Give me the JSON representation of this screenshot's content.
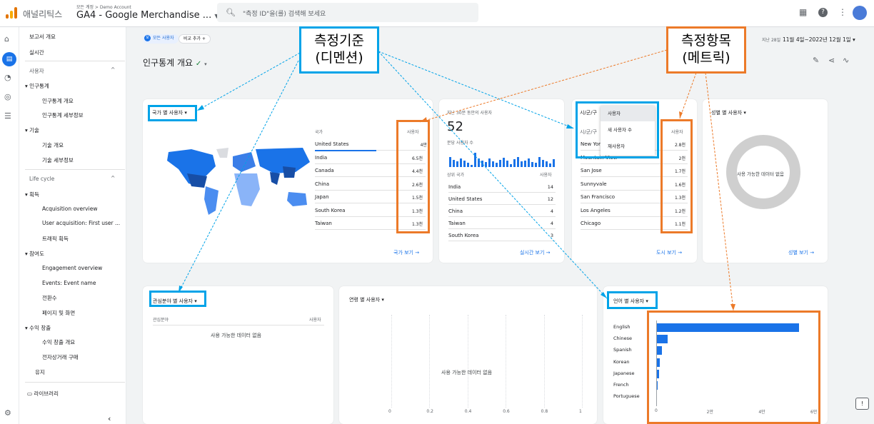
{
  "topbar": {
    "app_name": "애널리틱스",
    "breadcrumb": "모든 계정 > Demo Account",
    "property": "GA4 - Google Merchandise ...",
    "search_placeholder": "\"측정 ID\"을(를) 검색해 보세요"
  },
  "nav": {
    "overview": "보고서 개요",
    "realtime": "실시간",
    "user_section": "사용자",
    "demographics": "인구통계",
    "demo_overview": "인구통계 개요",
    "demo_details": "인구통계 세부정보",
    "tech": "기술",
    "tech_overview": "기술 개요",
    "tech_details": "기술 세부정보",
    "lifecycle": "Life cycle",
    "acquisition": "획득",
    "acq_overview": "Acquisition overview",
    "user_acq": "User acquisition: First user ...",
    "traffic_acq": "트래픽 획득",
    "engagement": "참여도",
    "eng_overview": "Engagement overview",
    "events": "Events: Event name",
    "conversions": "전환수",
    "pages": "페이지 및 화면",
    "monetization": "수익 창출",
    "mon_overview": "수익 창출 개요",
    "ecommerce": "전자상거래 구매",
    "retention": "유지",
    "library": "라이브러리"
  },
  "header": {
    "all_users_badge": "모",
    "all_users": "모든 사용자",
    "compare": "비교 추가",
    "page_title": "인구통계 개요",
    "date_label": "지난 28일",
    "date_range": "11월 4일~2022년 12월 1일"
  },
  "country_card": {
    "dropdown": "국가 별 사용자",
    "col1": "국가",
    "col2": "사용자",
    "rows": [
      {
        "name": "United States",
        "value": "4만"
      },
      {
        "name": "India",
        "value": "6.5천"
      },
      {
        "name": "Canada",
        "value": "4.4천"
      },
      {
        "name": "China",
        "value": "2.6천"
      },
      {
        "name": "Japan",
        "value": "1.5천"
      },
      {
        "name": "South Korea",
        "value": "1.3천"
      },
      {
        "name": "Taiwan",
        "value": "1.3천"
      }
    ],
    "link": "국가 보기"
  },
  "realtime_card": {
    "title": "지난 30분 동안의 사용자",
    "value": "52",
    "sub": "분당 사용자 수",
    "col1": "상위 국가",
    "col2": "사용자",
    "rows": [
      {
        "name": "India",
        "value": "14"
      },
      {
        "name": "United States",
        "value": "12"
      },
      {
        "name": "China",
        "value": "4"
      },
      {
        "name": "Taiwan",
        "value": "4"
      },
      {
        "name": "South Korea",
        "value": "3"
      }
    ],
    "link": "실시간 보기"
  },
  "city_card": {
    "dropdown": "시/군/구",
    "col2": "사용자",
    "menu": [
      "사용자",
      "새 사용자 수",
      "재사용자"
    ],
    "rows": [
      {
        "name": "New York",
        "value": "2.8천"
      },
      {
        "name": "Mountain View",
        "value": "2천"
      },
      {
        "name": "San Jose",
        "value": "1.7천"
      },
      {
        "name": "Sunnyvale",
        "value": "1.6천"
      },
      {
        "name": "San Francisco",
        "value": "1.3천"
      },
      {
        "name": "Los Angeles",
        "value": "1.2천"
      },
      {
        "name": "Chicago",
        "value": "1.1천"
      }
    ],
    "link": "도시 보기"
  },
  "gender_card": {
    "dropdown": "성별 별 사용자",
    "empty": "사용 가능한 데이터 없음",
    "link": "성별 보기"
  },
  "interest_card": {
    "dropdown": "관심분야 별 사용자",
    "col1": "관심분야",
    "col2": "사용자",
    "empty": "사용 가능한 데이터 없음"
  },
  "age_card": {
    "dropdown": "연령 별 사용자",
    "empty": "사용 가능한 데이터 없음",
    "ticks": [
      "0",
      "0.2",
      "0.4",
      "0.6",
      "0.8",
      "1"
    ]
  },
  "language_card": {
    "dropdown": "언어 별 사용자",
    "ticks": [
      "0",
      "2만",
      "4만",
      "6만"
    ],
    "xmax": 60000
  },
  "chart_data": {
    "type": "bar",
    "categories": [
      "English",
      "Chinese",
      "Spanish",
      "Korean",
      "Japanese",
      "French",
      "Portuguese"
    ],
    "values": [
      55000,
      4500,
      2300,
      1300,
      1200,
      500,
      400
    ],
    "xlim": [
      0,
      60000
    ]
  },
  "annotations": {
    "dimension": "측정기준\n(디멘션)",
    "metric": "측정항목\n(메트릭)"
  },
  "colors": {
    "accent": "#1a73e8",
    "annotation_blue": "#00a3e8",
    "annotation_orange": "#ec7a29"
  }
}
